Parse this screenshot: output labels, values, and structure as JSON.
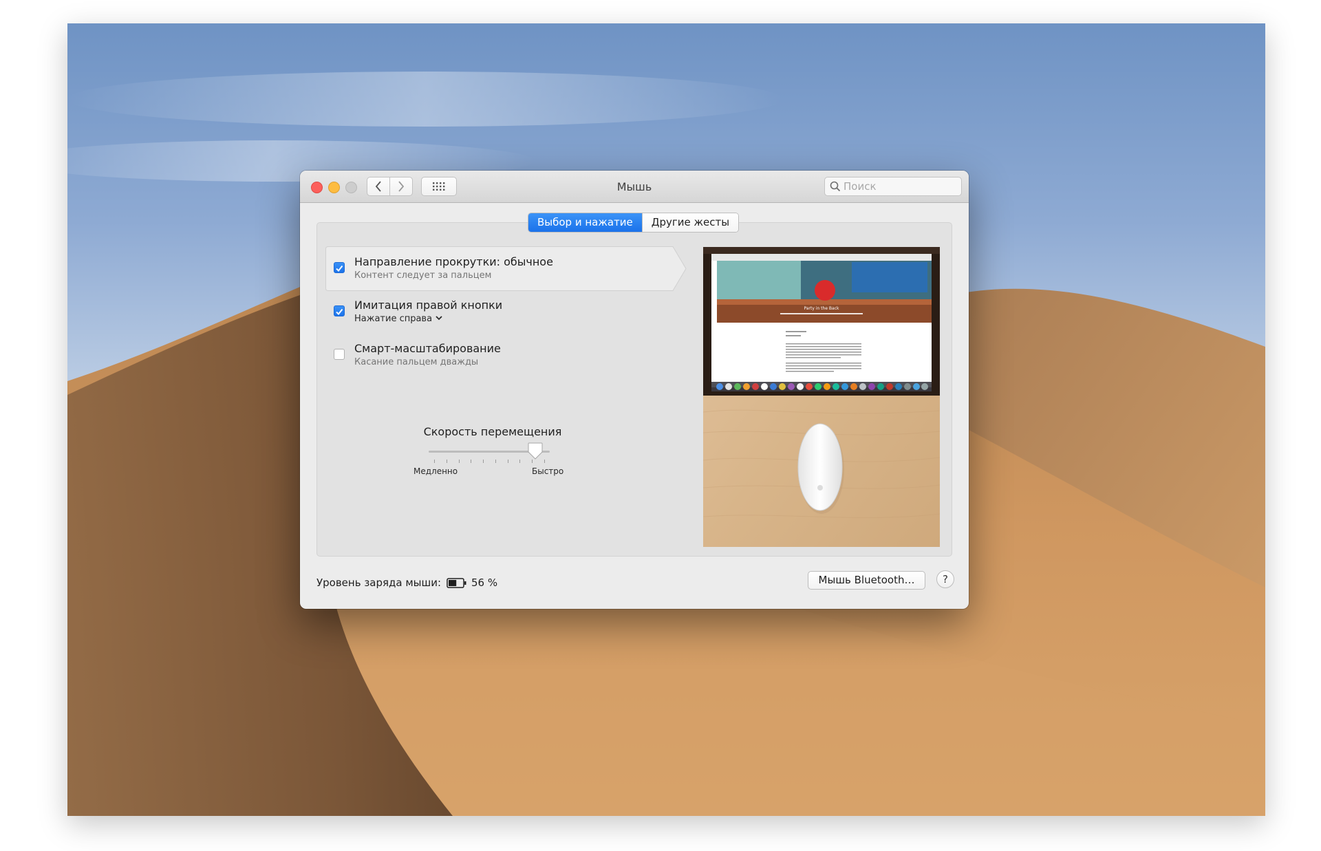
{
  "window": {
    "title": "Мышь"
  },
  "search": {
    "placeholder": "Поиск"
  },
  "tabs": [
    {
      "label": "Выбор и нажатие",
      "active": true
    },
    {
      "label": "Другие жесты",
      "active": false
    }
  ],
  "options": [
    {
      "label": "Направление прокрутки: обычное",
      "sublabel": "Контент следует за пальцем",
      "checked": true
    },
    {
      "label": "Имитация правой кнопки",
      "sublabel": "Нажатие справа",
      "checked": true
    },
    {
      "label": "Смарт-масштабирование",
      "sublabel": "Касание пальцем дважды",
      "checked": false
    }
  ],
  "speed": {
    "title": "Скорость перемещения",
    "min_label": "Медленно",
    "max_label": "Быстро",
    "value_fraction": 0.88,
    "ticks": 10
  },
  "preview": {
    "headline": "Party in the Back"
  },
  "footer": {
    "battery_label": "Уровень заряда мыши:",
    "battery_percent": "56 %",
    "battery_level": 0.56,
    "bluetooth_button": "Мышь Bluetooth…",
    "help_label": "?"
  },
  "colors": {
    "accent": "#1b72ea",
    "close": "#fc605c",
    "minimize": "#fdbc40"
  }
}
